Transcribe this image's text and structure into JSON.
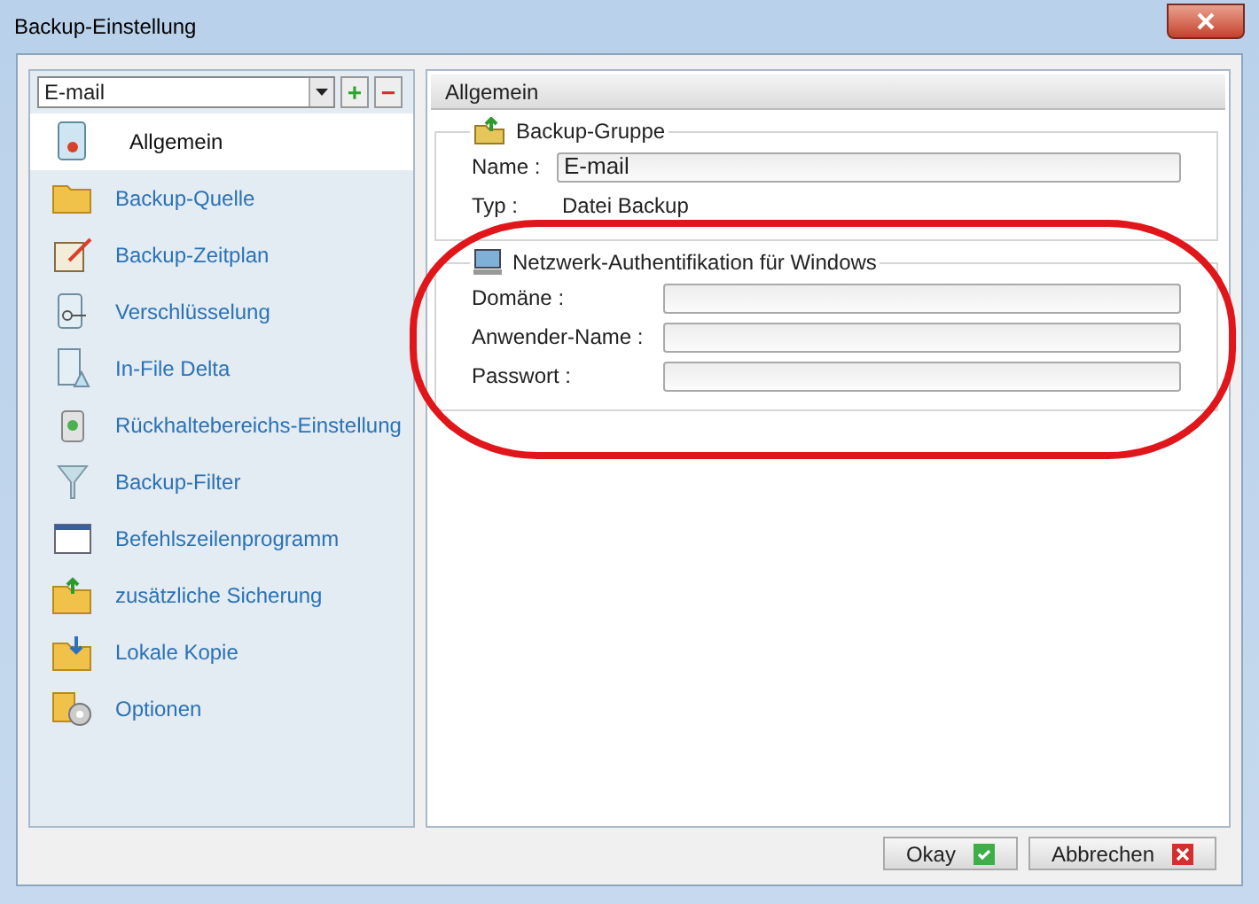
{
  "window": {
    "title": "Backup-Einstellung"
  },
  "group_select": {
    "value": "E-mail",
    "add": "+",
    "remove": "−"
  },
  "sidebar": {
    "items": [
      {
        "label": "Allgemein",
        "selected": true
      },
      {
        "label": "Backup-Quelle",
        "selected": false
      },
      {
        "label": "Backup-Zeitplan",
        "selected": false
      },
      {
        "label": "Verschlüsselung",
        "selected": false
      },
      {
        "label": "In-File Delta",
        "selected": false
      },
      {
        "label": "Rückhaltebereichs-Einstellung",
        "selected": false
      },
      {
        "label": "Backup-Filter",
        "selected": false
      },
      {
        "label": "Befehlszeilenprogramm",
        "selected": false
      },
      {
        "label": "zusätzliche Sicherung",
        "selected": false
      },
      {
        "label": "Lokale Kopie",
        "selected": false
      },
      {
        "label": "Optionen",
        "selected": false
      }
    ]
  },
  "panel": {
    "title": "Allgemein",
    "backup_group": {
      "title": "Backup-Gruppe",
      "name_label": "Name :",
      "name_value": "E-mail",
      "type_label": "Typ :",
      "type_value": "Datei Backup"
    },
    "network_auth": {
      "title": "Netzwerk-Authentifikation für Windows",
      "fields": [
        {
          "label": "Domäne :"
        },
        {
          "label": "Anwender-Name :"
        },
        {
          "label": "Passwort :"
        }
      ]
    }
  },
  "buttons": [
    {
      "label": "Okay",
      "kind": "ok"
    },
    {
      "label": "Abbrechen",
      "kind": "cancel"
    }
  ]
}
